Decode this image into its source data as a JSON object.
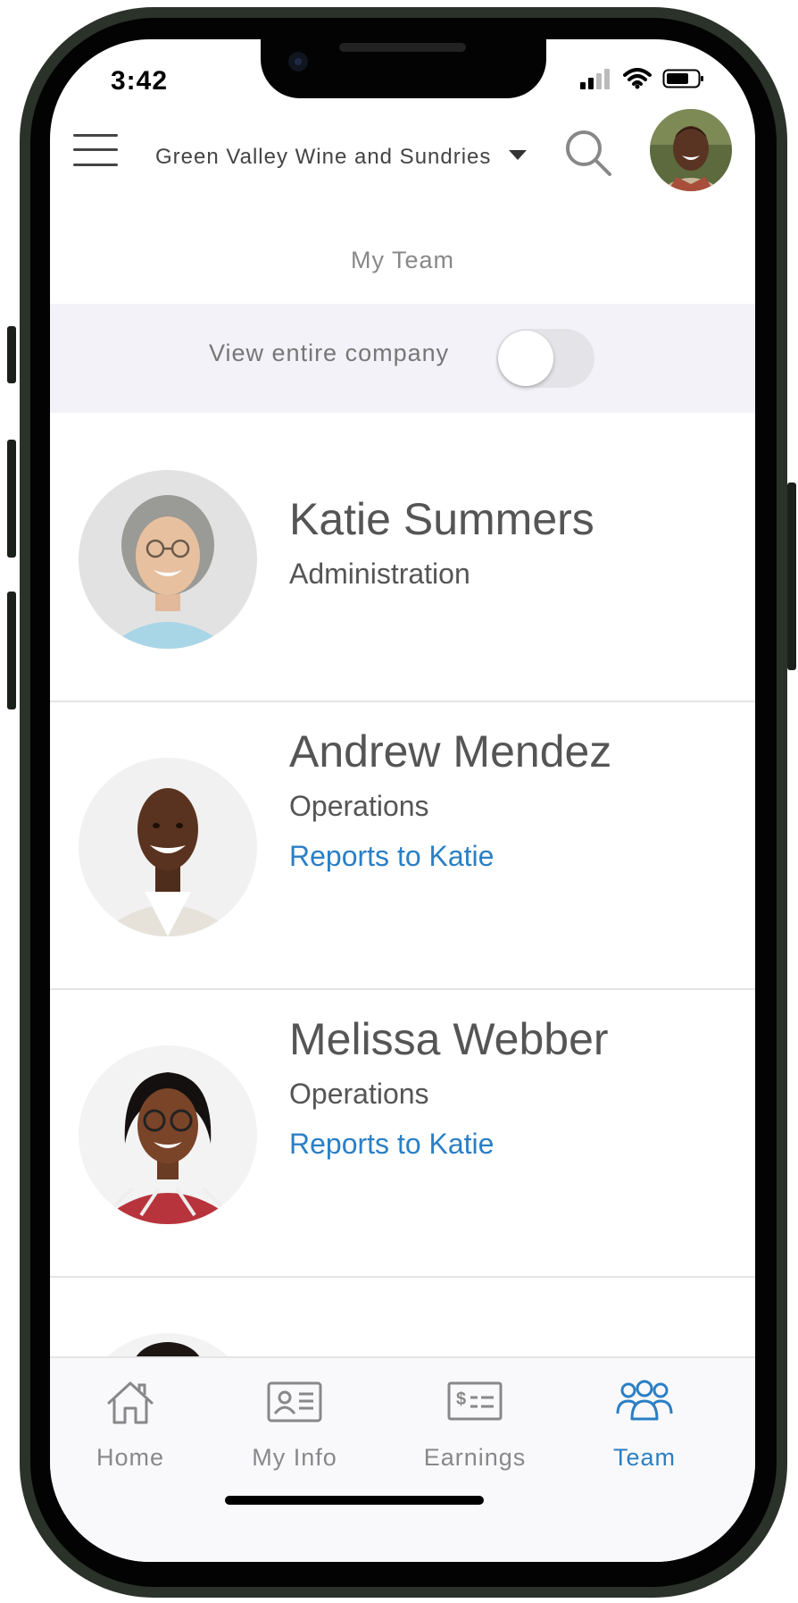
{
  "status_bar": {
    "time": "3:42"
  },
  "header": {
    "company": "Green Valley Wine and Sundries"
  },
  "page": {
    "title": "My Team"
  },
  "toggle": {
    "label": "View entire company",
    "on": false
  },
  "team": [
    {
      "name": "Katie Summers",
      "department": "Administration",
      "reports_to": ""
    },
    {
      "name": "Andrew Mendez",
      "department": "Operations",
      "reports_to": "Reports to Katie"
    },
    {
      "name": "Melissa Webber",
      "department": "Operations",
      "reports_to": "Reports to Katie"
    }
  ],
  "nav": [
    {
      "label": "Home",
      "icon": "home-icon",
      "active": false
    },
    {
      "label": "My Info",
      "icon": "id-card-icon",
      "active": false
    },
    {
      "label": "Earnings",
      "icon": "paycheck-icon",
      "active": false
    },
    {
      "label": "Team",
      "icon": "team-icon",
      "active": true
    }
  ],
  "colors": {
    "accent": "#2b7fc4",
    "toggle_bar": "#f2f2f8"
  }
}
